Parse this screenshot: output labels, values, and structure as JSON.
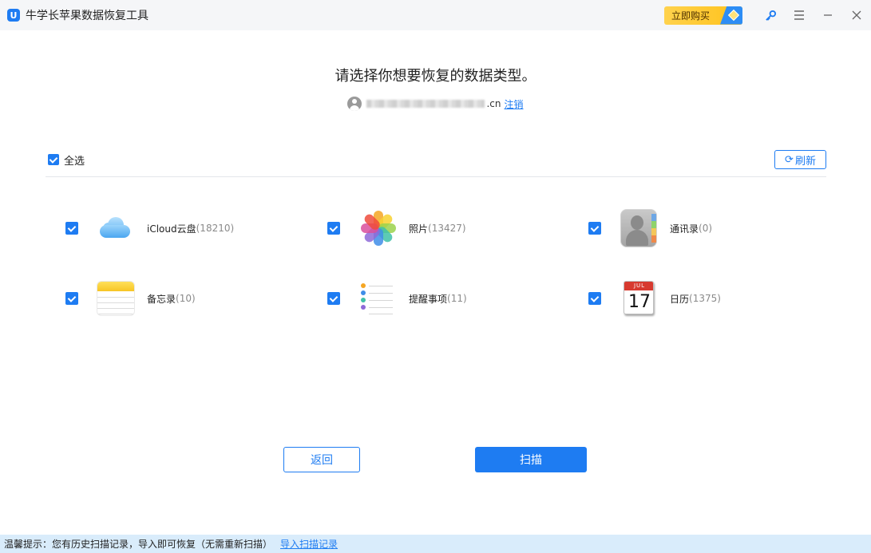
{
  "app": {
    "logo_letter": "U",
    "title": "牛学长苹果数据恢复工具",
    "buy_label": "立即购买"
  },
  "titlebar_icons": [
    "key-icon",
    "menu-icon",
    "minimize-icon",
    "close-icon"
  ],
  "heading": "请选择你想要恢复的数据类型。",
  "account": {
    "email_suffix": ".cn",
    "logout_label": "注销"
  },
  "select_all": {
    "label": "全选",
    "checked": true
  },
  "refresh_label": "刷新",
  "data_types": [
    {
      "name": "iCloud云盘",
      "count": "(18210)",
      "icon": "icloud-drive-icon",
      "checked": true
    },
    {
      "name": "照片",
      "count": "(13427)",
      "icon": "photos-icon",
      "checked": true
    },
    {
      "name": "通讯录",
      "count": "(0)",
      "icon": "contacts-icon",
      "checked": true
    },
    {
      "name": "备忘录",
      "count": "(10)",
      "icon": "notes-icon",
      "checked": true
    },
    {
      "name": "提醒事项",
      "count": "(11)",
      "icon": "reminders-icon",
      "checked": true
    },
    {
      "name": "日历",
      "count": "(1375)",
      "icon": "calendar-icon",
      "checked": true
    }
  ],
  "calendar_icon": {
    "month": "JUL",
    "day": "17"
  },
  "buttons": {
    "back": "返回",
    "scan": "扫描"
  },
  "tip": {
    "text": "温馨提示：您有历史扫描记录，导入即可恢复（无需重新扫描）",
    "link": "导入扫描记录"
  },
  "colors": {
    "accent": "#1e7cf2",
    "buy": "#ffc21a",
    "tip_bg": "#d9ecfb"
  }
}
